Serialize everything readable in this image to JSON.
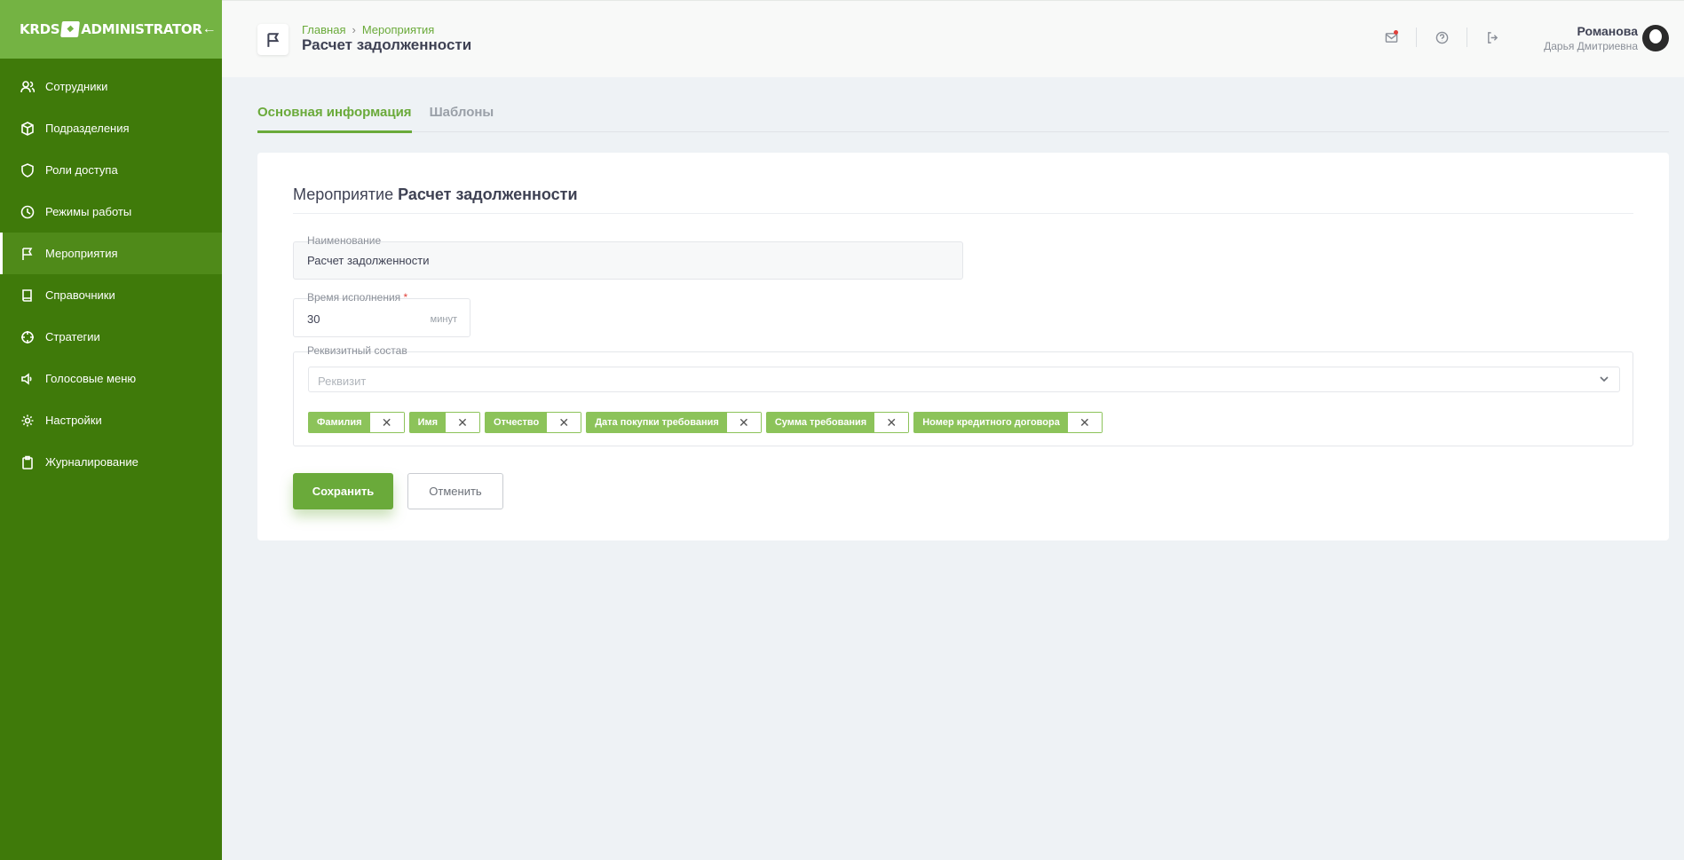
{
  "sidebar": {
    "logo_left": "KRDS",
    "logo_right": "ADMINISTRATOR",
    "collapse_icon": "arrow-left-icon",
    "items": [
      {
        "label": "Сотрудники",
        "icon": "users-icon"
      },
      {
        "label": "Подразделения",
        "icon": "cube-icon"
      },
      {
        "label": "Роли доступа",
        "icon": "shield-icon"
      },
      {
        "label": "Режимы работы",
        "icon": "clock-icon"
      },
      {
        "label": "Мероприятия",
        "icon": "flag-icon",
        "active": true
      },
      {
        "label": "Справочники",
        "icon": "book-icon"
      },
      {
        "label": "Стратегии",
        "icon": "crosshair-icon"
      },
      {
        "label": "Голосовые меню",
        "icon": "speaker-icon"
      },
      {
        "label": "Настройки",
        "icon": "gear-icon"
      },
      {
        "label": "Журналирование",
        "icon": "clipboard-icon"
      }
    ]
  },
  "header": {
    "breadcrumb": [
      "Главная",
      "Мероприятия"
    ],
    "breadcrumb_sep": "›",
    "title": "Расчет задолженности",
    "user": {
      "surname": "Романова",
      "name": "Дарья Дмитриевна"
    }
  },
  "tabs": [
    {
      "label": "Основная информация",
      "active": true
    },
    {
      "label": "Шаблоны",
      "active": false
    }
  ],
  "form": {
    "card_title_prefix": "Мероприятие",
    "card_title_name": "Расчет задолженности",
    "name_label": "Наименование",
    "name_value": "Расчет задолженности",
    "time_label": "Время исполнения",
    "time_required": "*",
    "time_value": "30",
    "time_unit": "минут",
    "req_label": "Реквизитный состав",
    "req_placeholder": "Реквизит",
    "chips": [
      "Фамилия",
      "Имя",
      "Отчество",
      "Дата покупки требования",
      "Сумма требования",
      "Номер кредитного договора"
    ],
    "chip_remove": "✕",
    "save_label": "Сохранить",
    "cancel_label": "Отменить"
  },
  "colors": {
    "sidebar_bg": "#3f7a0a",
    "brand_bg": "#74b343",
    "accent": "#6aaa3a",
    "chip": "#8cc35a"
  }
}
